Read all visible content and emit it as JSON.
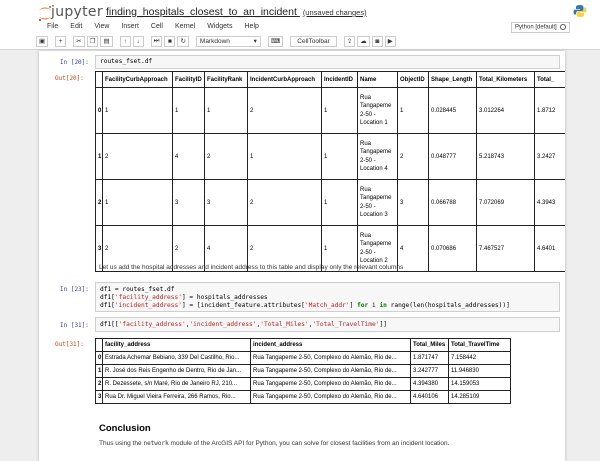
{
  "app": {
    "logo_text": "jupyter",
    "notebook_name": "finding_hospitals_closest_to_an_incident",
    "save_status": "(unsaved changes)",
    "kernel": "Python [default]"
  },
  "menu": [
    "File",
    "Edit",
    "View",
    "Insert",
    "Cell",
    "Kernel",
    "Widgets",
    "Help"
  ],
  "toolbar": {
    "cell_type": "Markdown",
    "celltoolbar_label": "CellToolbar",
    "icons": [
      "save-icon",
      "plus-icon",
      "cut-icon",
      "copy-icon",
      "paste-icon",
      "arrow-up-icon",
      "arrow-down-icon",
      "step-icon",
      "stop-icon",
      "restart-icon",
      "keyboard-icon",
      "upload-icon",
      "cloud-icon",
      "camera-icon",
      "video-icon"
    ]
  },
  "cells": {
    "c20": {
      "in_prompt": "In [20]:",
      "code": "routes_fset.df",
      "out_prompt": "Out[20]:",
      "table": {
        "headers": [
          "",
          "FacilityCurbApproach",
          "FacilityID",
          "FacilityRank",
          "IncidentCurbApproach",
          "IncidentID",
          "Name",
          "ObjectID",
          "Shape_Length",
          "Total_Kilometers",
          "Total_"
        ],
        "rows": [
          [
            "0",
            "1",
            "1",
            "1",
            "2",
            "1",
            "Rua Tangapeme 2-50 - Location 1",
            "1",
            "0.028445",
            "3.012264",
            "1.8712"
          ],
          [
            "1",
            "2",
            "4",
            "2",
            "1",
            "1",
            "Rua Tangapeme 2-50 - Location 4",
            "2",
            "0.048777",
            "5.218743",
            "3.2427"
          ],
          [
            "2",
            "1",
            "3",
            "3",
            "2",
            "1",
            "Rua Tangapeme 2-50 - Location 3",
            "3",
            "0.066788",
            "7.072069",
            "4.3943"
          ],
          [
            "3",
            "2",
            "2",
            "4",
            "2",
            "1",
            "Rua Tangapeme 2-50 - Location 2",
            "4",
            "0.070686",
            "7.467527",
            "4.6401"
          ]
        ]
      }
    },
    "md1": "Let us add the hospital addresses and incident address to this table and display only the relevant columns",
    "c23": {
      "in_prompt": "In [23]:",
      "line1": "df1 = routes_fset.df",
      "line2a": "df1[",
      "line2s": "'facility_address'",
      "line2b": "] = hospitals_addresses",
      "line3a": "df1[",
      "line3s": "'incident_address'",
      "line3b": "] = [incident_feature.attributes[",
      "line3s2": "'Match_addr'",
      "line3c": "] ",
      "line3k1": "for",
      "line3d": " i ",
      "line3k2": "in",
      "line3e": " range(len(hospitals_addresses))]"
    },
    "c31": {
      "in_prompt": "In [31]:",
      "code_a": "df1[[",
      "s1": "'facility_address'",
      "s2": "'incident_address'",
      "s3": "'Total_Miles'",
      "s4": "'Total_TravelTime'",
      "comma": ",",
      "code_b": "]]",
      "out_prompt": "Out[31]:",
      "table": {
        "headers": [
          "",
          "facility_address",
          "incident_address",
          "Total_Miles",
          "Total_TravelTime"
        ],
        "rows": [
          [
            "0",
            "Estrada Achemar Bebiano, 339 Del Castilho, Rio...",
            "Rua Tangapeme 2-50, Complexo do Alemão, Rio de...",
            "1.871747",
            "7.158442"
          ],
          [
            "1",
            "R. José dos Reis Engenho de Dentro, Rio de Jan...",
            "Rua Tangapeme 2-50, Complexo do Alemão, Rio de...",
            "3.242777",
            "11.946830"
          ],
          [
            "2",
            "R. Dezessete, s/n Maré, Rio de Janeiro RJ, 210...",
            "Rua Tangapeme 2-50, Complexo do Alemão, Rio de...",
            "4.394380",
            "14.159053"
          ],
          [
            "3",
            "Rua Dr. Miguel Vieira Ferreira, 266 Ramos, Rio...",
            "Rua Tangapeme 2-50, Complexo do Alemão, Rio de...",
            "4.640106",
            "14.285109"
          ]
        ]
      }
    },
    "conclusion_title": "Conclusion",
    "conclusion_pre": "Thus using the ",
    "conclusion_code": "network",
    "conclusion_post": " module of the ArcGIS API for Python, you can solve for closest facilities from an incident location."
  }
}
